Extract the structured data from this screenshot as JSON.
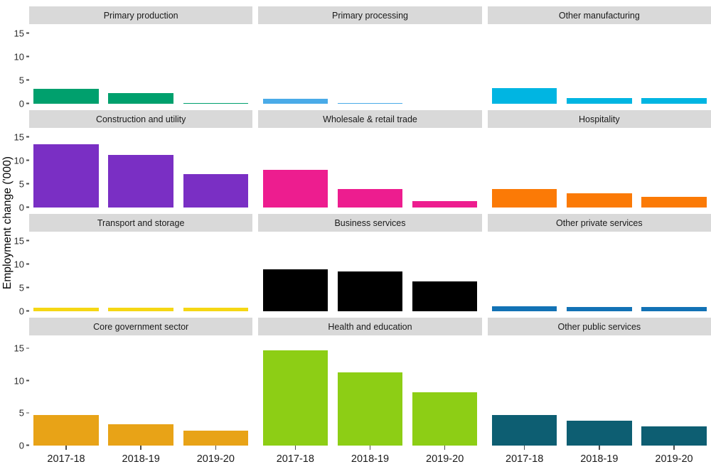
{
  "chart_data": {
    "type": "bar",
    "title": "",
    "xlabel": "",
    "ylabel": "Employment change ('000)",
    "categories": [
      "2017-18",
      "2018-19",
      "2019-20"
    ],
    "ylim": [
      0,
      17
    ],
    "yticks": [
      0,
      5,
      10,
      15
    ],
    "ytick_labels": [
      "0",
      "5",
      "10",
      "15"
    ],
    "grid": false,
    "legend": "none",
    "facet_layout": {
      "rows": 4,
      "cols": 3
    },
    "facets": [
      {
        "name": "Primary production",
        "color": "#00a06d",
        "values": [
          3.2,
          2.3,
          0.15
        ]
      },
      {
        "name": "Primary processing",
        "color": "#4aabe8",
        "values": [
          1.1,
          0.15,
          0.0
        ]
      },
      {
        "name": "Other manufacturing",
        "color": "#00b5e2",
        "values": [
          3.4,
          1.2,
          1.2
        ]
      },
      {
        "name": "Construction and utility",
        "color": "#7a2fc4",
        "values": [
          13.5,
          11.3,
          7.2
        ]
      },
      {
        "name": "Wholesale & retail trade",
        "color": "#ed1d8f",
        "values": [
          8.0,
          4.0,
          1.4
        ]
      },
      {
        "name": "Hospitality",
        "color": "#fb7a06",
        "values": [
          4.0,
          3.1,
          2.3
        ]
      },
      {
        "name": "Transport and storage",
        "color": "#f5d714",
        "values": [
          0.8,
          0.7,
          0.7
        ]
      },
      {
        "name": "Business services",
        "color": "#000000",
        "values": [
          8.9,
          8.5,
          6.4
        ]
      },
      {
        "name": "Other private services",
        "color": "#1272b5",
        "values": [
          1.0,
          0.9,
          0.9
        ]
      },
      {
        "name": "Core government sector",
        "color": "#e8a317",
        "values": [
          4.7,
          3.3,
          2.3
        ]
      },
      {
        "name": "Health and education",
        "color": "#8dce15",
        "values": [
          14.7,
          11.3,
          8.2
        ]
      },
      {
        "name": "Other public services",
        "color": "#0d5e72",
        "values": [
          4.7,
          3.8,
          3.0
        ]
      }
    ]
  },
  "axis": {
    "y_title": "Employment change ('000)"
  },
  "strip_background": "#d9d9d9",
  "panel_background": "#ffffff"
}
